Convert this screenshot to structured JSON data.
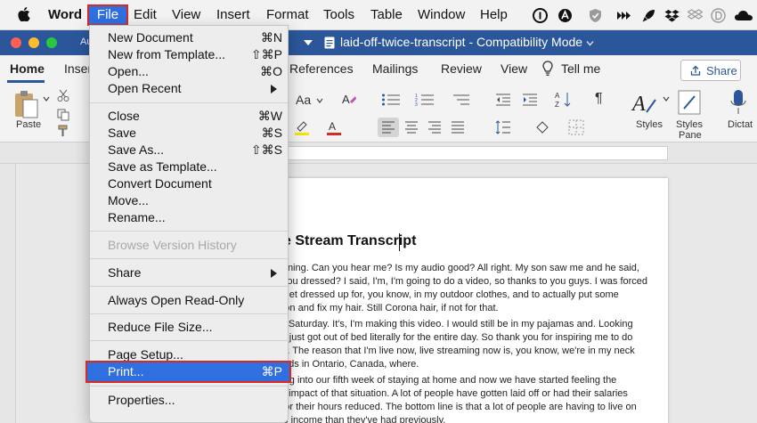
{
  "menubar": {
    "app_name": "Word",
    "file": "File",
    "items": [
      "Edit",
      "View",
      "Insert",
      "Format",
      "Tools",
      "Table",
      "Window",
      "Help"
    ],
    "tray_icons": [
      "circled-1-icon",
      "circled-a-icon",
      "lastpass-icon",
      "shield-check-icon",
      "forward-arrow-icon",
      "rocket-icon",
      "dropbox-icon",
      "dropbox-outline-icon",
      "d-circle-icon",
      "cloud-icon"
    ]
  },
  "window": {
    "title": "laid-off-twice-transcript",
    "mode": "Compatibility Mode",
    "autosave_label": "Au"
  },
  "ribbon": {
    "tabs": [
      "Home",
      "Inser",
      "References",
      "Mailings",
      "Review",
      "View"
    ],
    "tell_me": "Tell me",
    "share": "Share",
    "paste_label": "Paste",
    "styles_label": "Styles",
    "styles_pane_label": "Styles",
    "styles_pane_label2": "Pane",
    "dictate_label": "Dictat",
    "font_size_label": "Aa"
  },
  "document": {
    "heading": "e Stream Transcript",
    "para1": [
      "morning. Can you hear me? Is my audio good? All right. My son saw me and he said,",
      "re you dressed? I said, I'm, I'm going to do a video, so thanks to you guys. I was forced",
      "o. Get dressed up for, you know, in my outdoor clothes, and to actually put some",
      "up on and fix my hair. Still Corona hair, if not for that."
    ],
    "para2": [
      "'s a Saturday. It's, I'm making this video. I would still be in my pajamas and. Looking",
      "ot it just got out of bed literally for the entire day. So thank you for inspiring me to do",
      "deo. The reason that I'm  live now, live streaming now is, you know, we're in my neck",
      "woods in Ontario, Canada, where."
    ],
    "para3": [
      "going into our fifth week of staying at home and now we have started feeling the",
      "mic impact of that situation. A lot of people have gotten laid off or had their salaries",
      "ed or their hours reduced. The bottom line is that a lot of people are having to live on",
      "less income than they've had previously."
    ]
  },
  "file_menu": {
    "new_document": "New Document",
    "new_document_sc": "⌘N",
    "new_from_template": "New from Template...",
    "new_from_template_sc": "⇧⌘P",
    "open": "Open...",
    "open_sc": "⌘O",
    "open_recent": "Open Recent",
    "close": "Close",
    "close_sc": "⌘W",
    "save": "Save",
    "save_sc": "⌘S",
    "save_as": "Save As...",
    "save_as_sc": "⇧⌘S",
    "save_as_template": "Save as Template...",
    "convert_document": "Convert Document",
    "move": "Move...",
    "rename": "Rename...",
    "browse_version_history": "Browse Version History",
    "share": "Share",
    "always_open_read_only": "Always Open Read-Only",
    "reduce_file_size": "Reduce File Size...",
    "page_setup": "Page Setup...",
    "print": "Print...",
    "print_sc": "⌘P",
    "properties": "Properties..."
  },
  "colors": {
    "titlebar": "#2b579a",
    "menu_highlight": "#2f6fe0",
    "callout_border": "#d62a22"
  }
}
